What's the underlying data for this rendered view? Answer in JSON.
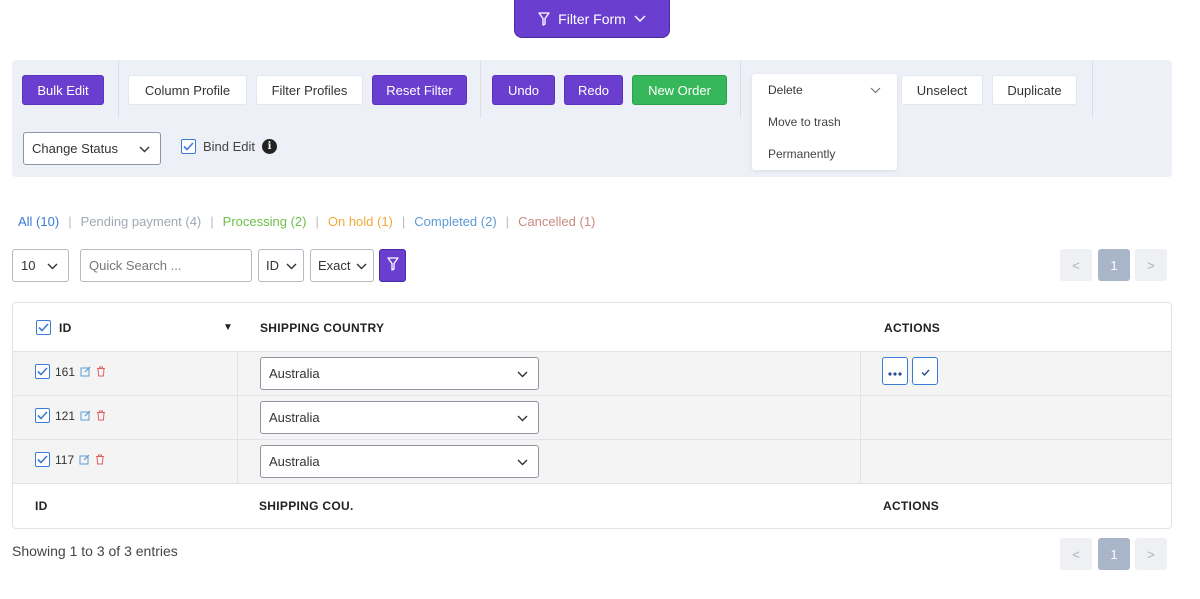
{
  "filter_form": {
    "label": "Filter Form"
  },
  "toolbar": {
    "bulk_edit": "Bulk Edit",
    "column_profile": "Column Profile",
    "filter_profiles": "Filter Profiles",
    "reset_filter": "Reset Filter",
    "undo": "Undo",
    "redo": "Redo",
    "new_order": "New Order",
    "delete_dropdown": {
      "selected": "Delete",
      "options": [
        "Move to trash",
        "Permanently"
      ]
    },
    "unselect": "Unselect",
    "duplicate": "Duplicate",
    "change_status": "Change Status",
    "bind_edit": "Bind Edit",
    "bind_edit_checked": true
  },
  "status_filters": [
    {
      "label": "All (10)",
      "color": "#3a7bd5"
    },
    {
      "label": "Pending payment (4)",
      "color": "#a0a8b3"
    },
    {
      "label": "Processing (2)",
      "color": "#6cc04a"
    },
    {
      "label": "On hold (1)",
      "color": "#f0a93b"
    },
    {
      "label": "Completed (2)",
      "color": "#5b9bd5"
    },
    {
      "label": "Cancelled (1)",
      "color": "#c98a80"
    }
  ],
  "search_bar": {
    "per_page": "10",
    "quick_search_placeholder": "Quick Search ...",
    "field": "ID",
    "match": "Exact"
  },
  "pagination": {
    "prev": "<",
    "current": "1",
    "next": ">"
  },
  "table": {
    "headers": {
      "id": "ID",
      "shipping_country": "SHIPPING COUNTRY",
      "actions": "ACTIONS"
    },
    "footers": {
      "id": "ID",
      "shipping_country": "SHIPPING COU.",
      "actions": "ACTIONS"
    },
    "rows": [
      {
        "id": "161",
        "country": "Australia",
        "checked": true
      },
      {
        "id": "121",
        "country": "Australia",
        "checked": true
      },
      {
        "id": "117",
        "country": "Australia",
        "checked": true
      }
    ],
    "action_icons": [
      "more-icon",
      "check-icon"
    ]
  },
  "footer": {
    "showing": "Showing 1 to 3 of 3 entries"
  },
  "colors": {
    "accent": "#6a3fd0",
    "success": "#36b85a",
    "link": "#3a7bd5"
  }
}
